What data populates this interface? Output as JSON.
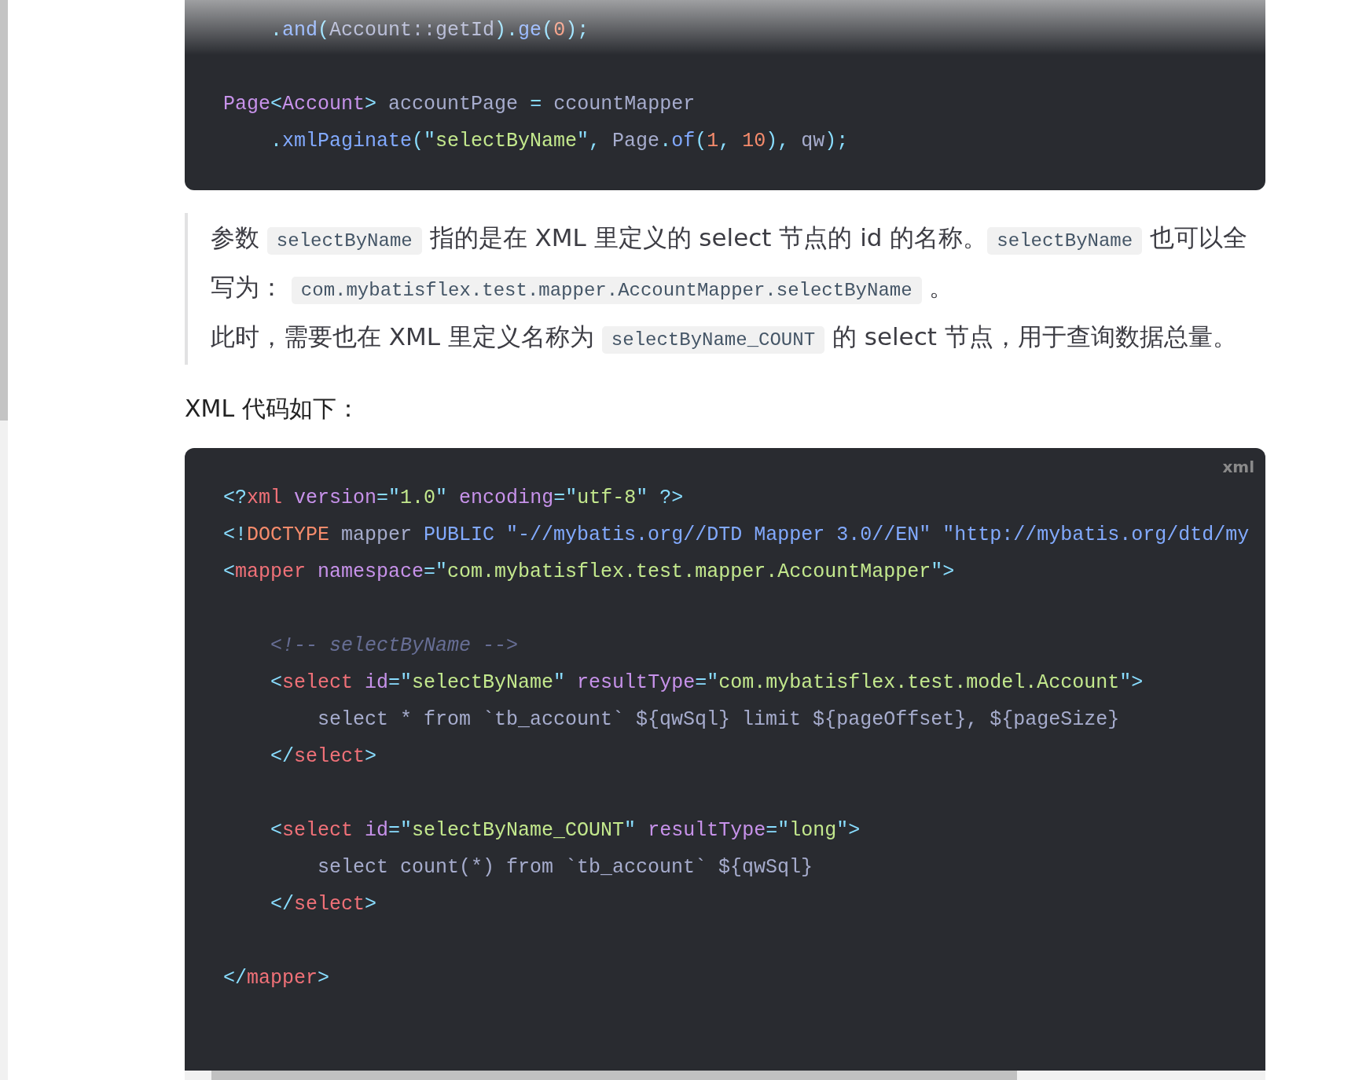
{
  "top_code": {
    "groups": [
      [
        [
          {
            "text": "    .",
            "kind": "punct"
          },
          {
            "text": "and",
            "kind": "function"
          },
          {
            "text": "(",
            "kind": "punct"
          },
          {
            "text": "Account::getId",
            "kind": "plain"
          },
          {
            "text": ").",
            "kind": "punct"
          },
          {
            "text": "ge",
            "kind": "function"
          },
          {
            "text": "(",
            "kind": "punct"
          },
          {
            "text": "0",
            "kind": "number"
          },
          {
            "text": ");",
            "kind": "punct"
          }
        ]
      ],
      [
        [
          {
            "text": "Page",
            "kind": "attr"
          },
          {
            "text": "<",
            "kind": "punct"
          },
          {
            "text": "Account",
            "kind": "attr"
          },
          {
            "text": ">",
            "kind": "punct"
          },
          {
            "text": " accountPage ",
            "kind": "plain"
          },
          {
            "text": "=",
            "kind": "punct"
          },
          {
            "text": " ccountMapper",
            "kind": "plain"
          }
        ],
        [
          {
            "text": "    .",
            "kind": "punct"
          },
          {
            "text": "xmlPaginate",
            "kind": "function"
          },
          {
            "text": "(\"",
            "kind": "punct"
          },
          {
            "text": "selectByName",
            "kind": "string"
          },
          {
            "text": "\",",
            "kind": "punct"
          },
          {
            "text": " Page",
            "kind": "plain"
          },
          {
            "text": ".",
            "kind": "punct"
          },
          {
            "text": "of",
            "kind": "function"
          },
          {
            "text": "(",
            "kind": "punct"
          },
          {
            "text": "1",
            "kind": "number"
          },
          {
            "text": ", ",
            "kind": "punct"
          },
          {
            "text": "10",
            "kind": "number"
          },
          {
            "text": "),",
            "kind": "punct"
          },
          {
            "text": " qw",
            "kind": "plain"
          },
          {
            "text": ");",
            "kind": "punct"
          }
        ]
      ]
    ]
  },
  "note": {
    "paragraphs": [
      [
        {
          "text": "参数 ",
          "kind": "text"
        },
        {
          "text": "selectByName",
          "kind": "code"
        },
        {
          "text": " 指的是在 XML 里定义的 select 节点的 id 的名称。",
          "kind": "text"
        },
        {
          "text": "selectByName",
          "kind": "code"
        },
        {
          "text": " 也可以全写为： ",
          "kind": "text"
        },
        {
          "text": "com.mybatisflex.test.mapper.AccountMapper.selectByName",
          "kind": "code"
        },
        {
          "text": " 。",
          "kind": "text"
        }
      ],
      [
        {
          "text": "此时，需要也在 XML 里定义名称为 ",
          "kind": "text"
        },
        {
          "text": "selectByName_COUNT",
          "kind": "code"
        },
        {
          "text": " 的 select 节点，用于查询数据总量。",
          "kind": "text"
        }
      ]
    ]
  },
  "heading": "XML 代码如下：",
  "xml_code": {
    "language": "xml",
    "groups": [
      [
        [
          {
            "text": "<?",
            "kind": "punct"
          },
          {
            "text": "xml",
            "kind": "tag"
          },
          {
            "text": " version",
            "kind": "attr"
          },
          {
            "text": "=\"",
            "kind": "punct"
          },
          {
            "text": "1.0",
            "kind": "string"
          },
          {
            "text": "\"",
            "kind": "punct"
          },
          {
            "text": " encoding",
            "kind": "attr"
          },
          {
            "text": "=\"",
            "kind": "punct"
          },
          {
            "text": "utf-8",
            "kind": "string"
          },
          {
            "text": "\" ?>",
            "kind": "punct"
          }
        ],
        [
          {
            "text": "<!",
            "kind": "punct"
          },
          {
            "text": "DOCTYPE",
            "kind": "doctype"
          },
          {
            "text": " mapper ",
            "kind": "plain"
          },
          {
            "text": "PUBLIC \"-//mybatis.org//DTD Mapper 3.0//EN\" \"http://mybatis.org/dtd/my",
            "kind": "function"
          }
        ],
        [
          {
            "text": "<",
            "kind": "punct"
          },
          {
            "text": "mapper",
            "kind": "tag"
          },
          {
            "text": " namespace",
            "kind": "attr"
          },
          {
            "text": "=\"",
            "kind": "punct"
          },
          {
            "text": "com.mybatisflex.test.mapper.AccountMapper",
            "kind": "string"
          },
          {
            "text": "\">",
            "kind": "punct"
          }
        ]
      ],
      [
        [
          {
            "text": "    <!-- selectByName -->",
            "kind": "comment"
          }
        ],
        [
          {
            "text": "    <",
            "kind": "punct"
          },
          {
            "text": "select",
            "kind": "tag"
          },
          {
            "text": " id",
            "kind": "attr"
          },
          {
            "text": "=\"",
            "kind": "punct"
          },
          {
            "text": "selectByName",
            "kind": "string"
          },
          {
            "text": "\"",
            "kind": "punct"
          },
          {
            "text": " resultType",
            "kind": "attr"
          },
          {
            "text": "=\"",
            "kind": "punct"
          },
          {
            "text": "com.mybatisflex.test.model.Account",
            "kind": "string"
          },
          {
            "text": "\">",
            "kind": "punct"
          }
        ],
        [
          {
            "text": "        select * from `tb_account` ${qwSql} limit ${pageOffset}, ${pageSize}",
            "kind": "plain"
          }
        ],
        [
          {
            "text": "    </",
            "kind": "punct"
          },
          {
            "text": "select",
            "kind": "tag"
          },
          {
            "text": ">",
            "kind": "punct"
          }
        ]
      ],
      [
        [
          {
            "text": "    <",
            "kind": "punct"
          },
          {
            "text": "select",
            "kind": "tag"
          },
          {
            "text": " id",
            "kind": "attr"
          },
          {
            "text": "=\"",
            "kind": "punct"
          },
          {
            "text": "selectByName_COUNT",
            "kind": "string"
          },
          {
            "text": "\"",
            "kind": "punct"
          },
          {
            "text": " resultType",
            "kind": "attr"
          },
          {
            "text": "=\"",
            "kind": "punct"
          },
          {
            "text": "long",
            "kind": "string"
          },
          {
            "text": "\">",
            "kind": "punct"
          }
        ],
        [
          {
            "text": "        select count(*) from `tb_account` ${qwSql}",
            "kind": "plain"
          }
        ],
        [
          {
            "text": "    </",
            "kind": "punct"
          },
          {
            "text": "select",
            "kind": "tag"
          },
          {
            "text": ">",
            "kind": "punct"
          }
        ]
      ],
      [
        [
          {
            "text": "</",
            "kind": "punct"
          },
          {
            "text": "mapper",
            "kind": "tag"
          },
          {
            "text": ">",
            "kind": "punct"
          }
        ]
      ]
    ]
  }
}
